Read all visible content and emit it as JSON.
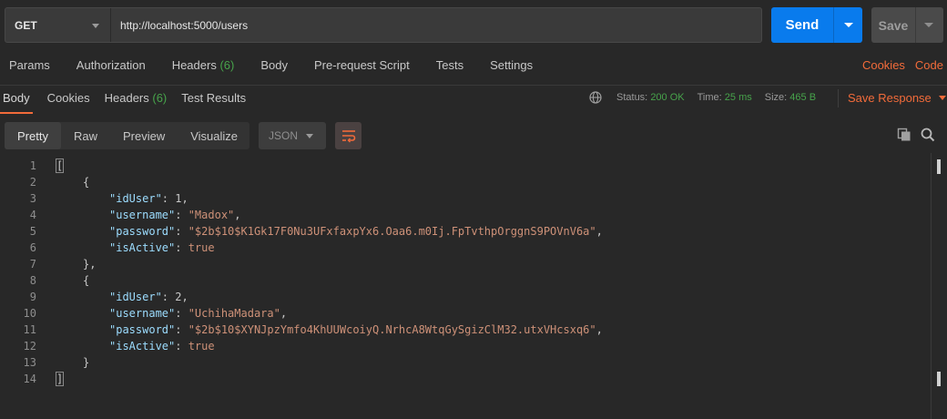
{
  "request": {
    "method": "GET",
    "url": "http://localhost:5000/users",
    "send_label": "Send",
    "save_label": "Save"
  },
  "request_tabs": [
    {
      "label": "Params",
      "count": ""
    },
    {
      "label": "Authorization",
      "count": ""
    },
    {
      "label": "Headers",
      "count": "(6)"
    },
    {
      "label": "Body",
      "count": ""
    },
    {
      "label": "Pre-request Script",
      "count": ""
    },
    {
      "label": "Tests",
      "count": ""
    },
    {
      "label": "Settings",
      "count": ""
    }
  ],
  "request_right": {
    "cookies": "Cookies",
    "code": "Code"
  },
  "response_tabs": [
    {
      "label": "Body",
      "count": ""
    },
    {
      "label": "Cookies",
      "count": ""
    },
    {
      "label": "Headers",
      "count": "(6)"
    },
    {
      "label": "Test Results",
      "count": ""
    }
  ],
  "response_meta": {
    "status_label": "Status:",
    "status_value": "200 OK",
    "time_label": "Time:",
    "time_value": "25 ms",
    "size_label": "Size:",
    "size_value": "465 B",
    "save_response": "Save Response"
  },
  "view_modes": [
    "Pretty",
    "Raw",
    "Preview",
    "Visualize"
  ],
  "format": "JSON",
  "code_lines": [
    {
      "n": "1",
      "parts": [
        {
          "t": "[",
          "c": "bracket-hl"
        }
      ],
      "indent": 0
    },
    {
      "n": "2",
      "parts": [
        {
          "t": "{",
          "c": ""
        }
      ],
      "indent": 1
    },
    {
      "n": "3",
      "parts": [
        {
          "t": "\"idUser\"",
          "c": "key"
        },
        {
          "t": ": ",
          "c": ""
        },
        {
          "t": "1",
          "c": "num"
        },
        {
          "t": ",",
          "c": ""
        }
      ],
      "indent": 2
    },
    {
      "n": "4",
      "parts": [
        {
          "t": "\"username\"",
          "c": "key"
        },
        {
          "t": ": ",
          "c": ""
        },
        {
          "t": "\"Madox\"",
          "c": "str"
        },
        {
          "t": ",",
          "c": ""
        }
      ],
      "indent": 2
    },
    {
      "n": "5",
      "parts": [
        {
          "t": "\"password\"",
          "c": "key"
        },
        {
          "t": ": ",
          "c": ""
        },
        {
          "t": "\"$2b$10$K1Gk17F0Nu3UFxfaxpYx6.Oaa6.m0Ij.FpTvthpOrggnS9POVnV6a\"",
          "c": "str"
        },
        {
          "t": ",",
          "c": ""
        }
      ],
      "indent": 2
    },
    {
      "n": "6",
      "parts": [
        {
          "t": "\"isActive\"",
          "c": "key"
        },
        {
          "t": ": ",
          "c": ""
        },
        {
          "t": "true",
          "c": "bool"
        }
      ],
      "indent": 2
    },
    {
      "n": "7",
      "parts": [
        {
          "t": "},",
          "c": ""
        }
      ],
      "indent": 1
    },
    {
      "n": "8",
      "parts": [
        {
          "t": "{",
          "c": ""
        }
      ],
      "indent": 1
    },
    {
      "n": "9",
      "parts": [
        {
          "t": "\"idUser\"",
          "c": "key"
        },
        {
          "t": ": ",
          "c": ""
        },
        {
          "t": "2",
          "c": "num"
        },
        {
          "t": ",",
          "c": ""
        }
      ],
      "indent": 2
    },
    {
      "n": "10",
      "parts": [
        {
          "t": "\"username\"",
          "c": "key"
        },
        {
          "t": ": ",
          "c": ""
        },
        {
          "t": "\"UchihaMadara\"",
          "c": "str"
        },
        {
          "t": ",",
          "c": ""
        }
      ],
      "indent": 2
    },
    {
      "n": "11",
      "parts": [
        {
          "t": "\"password\"",
          "c": "key"
        },
        {
          "t": ": ",
          "c": ""
        },
        {
          "t": "\"$2b$10$XYNJpzYmfo4KhUUWcoiyQ.NrhcA8WtqGySgizClM32.utxVHcsxq6\"",
          "c": "str"
        },
        {
          "t": ",",
          "c": ""
        }
      ],
      "indent": 2
    },
    {
      "n": "12",
      "parts": [
        {
          "t": "\"isActive\"",
          "c": "key"
        },
        {
          "t": ": ",
          "c": ""
        },
        {
          "t": "true",
          "c": "bool"
        }
      ],
      "indent": 2
    },
    {
      "n": "13",
      "parts": [
        {
          "t": "}",
          "c": ""
        }
      ],
      "indent": 1
    },
    {
      "n": "14",
      "parts": [
        {
          "t": "]",
          "c": "bracket-hl"
        }
      ],
      "indent": 0
    }
  ],
  "colors": {
    "accent": "#f26b3a",
    "send": "#097bed",
    "status_ok": "#47a34b",
    "json_key": "#9cdcfe",
    "json_string": "#ce9178"
  },
  "icons": [
    "globe-icon",
    "wrap-lines-icon",
    "copy-icon",
    "search-icon"
  ]
}
